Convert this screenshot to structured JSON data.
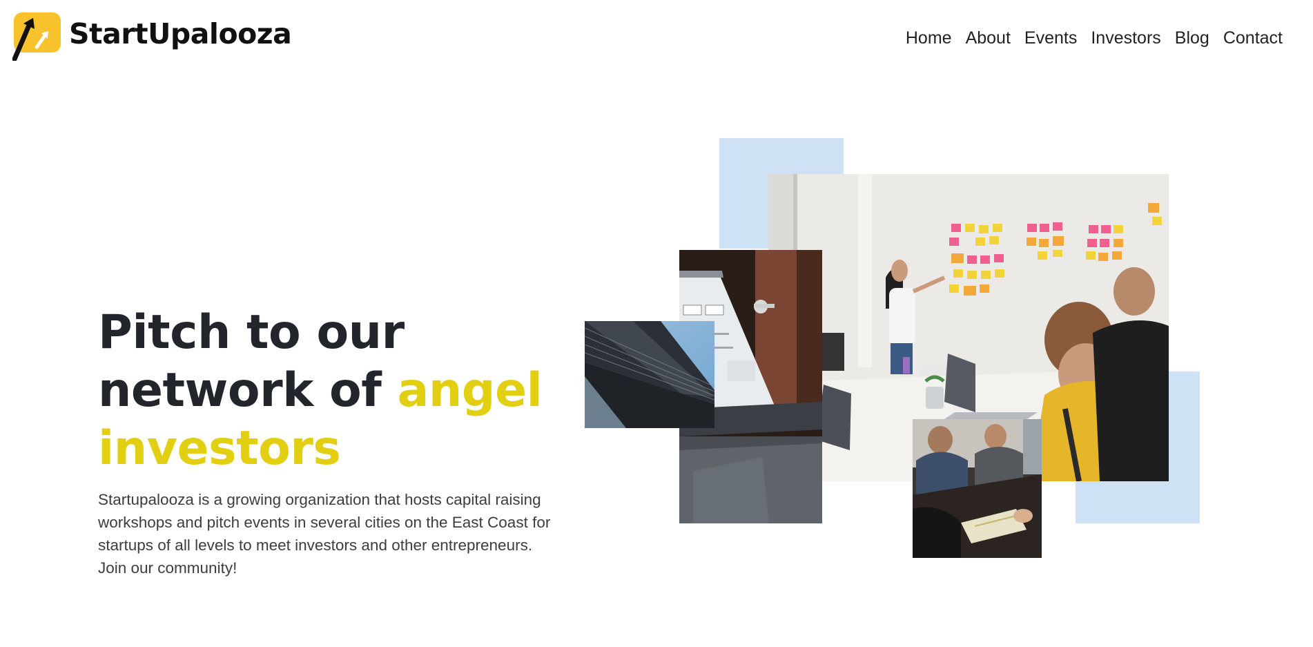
{
  "header": {
    "logo_text": "StartUpalooza",
    "logo_icon": "rising-arrow-logo-icon",
    "nav": [
      {
        "label": "Home"
      },
      {
        "label": "About"
      },
      {
        "label": "Events"
      },
      {
        "label": "Investors"
      },
      {
        "label": "Blog"
      },
      {
        "label": "Contact"
      }
    ]
  },
  "hero": {
    "title_line1": "Pitch to our",
    "title_line2_plain": "network of ",
    "title_line2_accent": "angel",
    "title_line3_accent": "investors",
    "description": "Startupalooza is a growing organization that hosts capital raising workshops and pitch events in several cities on the East Coast for startups of all levels to meet investors and other entrepreneurs. Join our community!"
  },
  "collage": {
    "photos": [
      {
        "name": "office-whiteboard-meeting-photo"
      },
      {
        "name": "laptop-analytics-photo"
      },
      {
        "name": "skyscraper-photo"
      },
      {
        "name": "team-at-table-photo"
      }
    ]
  },
  "colors": {
    "accent_yellow": "#e3cf12",
    "logo_yellow": "#f7c22b",
    "heading_dark": "#22252b",
    "light_blue_block": "#cfe1f4"
  }
}
